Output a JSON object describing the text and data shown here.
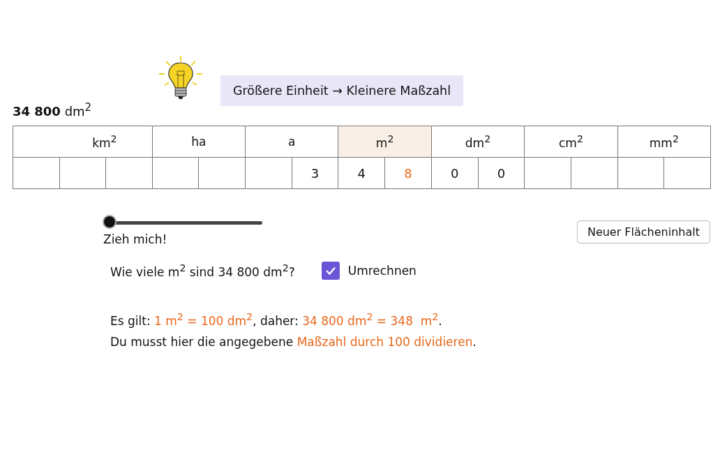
{
  "hint": {
    "text": "Größere Einheit → Kleinere Maßzahl"
  },
  "value": {
    "number": "34 800",
    "unit": "dm$^{2}$"
  },
  "table": {
    "units": [
      {
        "label": "km$^{2}$",
        "highlighted": false,
        "cells": [
          null,
          null,
          null
        ]
      },
      {
        "label": "ha",
        "highlighted": false,
        "cells": [
          null,
          null
        ]
      },
      {
        "label": "a",
        "highlighted": false,
        "cells": [
          null,
          {
            "digit": "3",
            "highlight": false
          }
        ]
      },
      {
        "label": "m$^{2}$",
        "highlighted": true,
        "cells": [
          {
            "digit": "4",
            "highlight": false
          },
          {
            "digit": "8",
            "highlight": true
          }
        ]
      },
      {
        "label": "dm$^{2}$",
        "highlighted": false,
        "cells": [
          {
            "digit": "0",
            "highlight": false
          },
          {
            "digit": "0",
            "highlight": false
          }
        ]
      },
      {
        "label": "cm$^{2}$",
        "highlighted": false,
        "cells": [
          null,
          null
        ]
      },
      {
        "label": "mm$^{2}$",
        "highlighted": false,
        "cells": [
          null,
          null
        ]
      }
    ]
  },
  "slider": {
    "label": "Zieh mich!",
    "level": 0
  },
  "new_button": {
    "label": "Neuer Flächeninhalt"
  },
  "question": {
    "text": "Wie viele m$^{2}$ sind 34 800 dm$^{2}$?"
  },
  "convert_checkbox": {
    "label": "Umrechnen",
    "checked": true
  },
  "explanation": [
    [
      {
        "text": "Es gilt: ",
        "highlight": false
      },
      {
        "text": "1 m$^{2}$ = 100 dm$^{2}$",
        "highlight": true
      },
      {
        "text": ", daher: ",
        "highlight": false
      },
      {
        "text": "34 800 dm$^{2}$ = 348  m$^{2}$",
        "highlight": true
      },
      {
        "text": ".",
        "highlight": false
      }
    ],
    [
      {
        "text": "Du musst hier die angegebene ",
        "highlight": false
      },
      {
        "text": "Maßzahl durch 100 dividieren",
        "highlight": true
      },
      {
        "text": ".",
        "highlight": false
      }
    ]
  ]
}
